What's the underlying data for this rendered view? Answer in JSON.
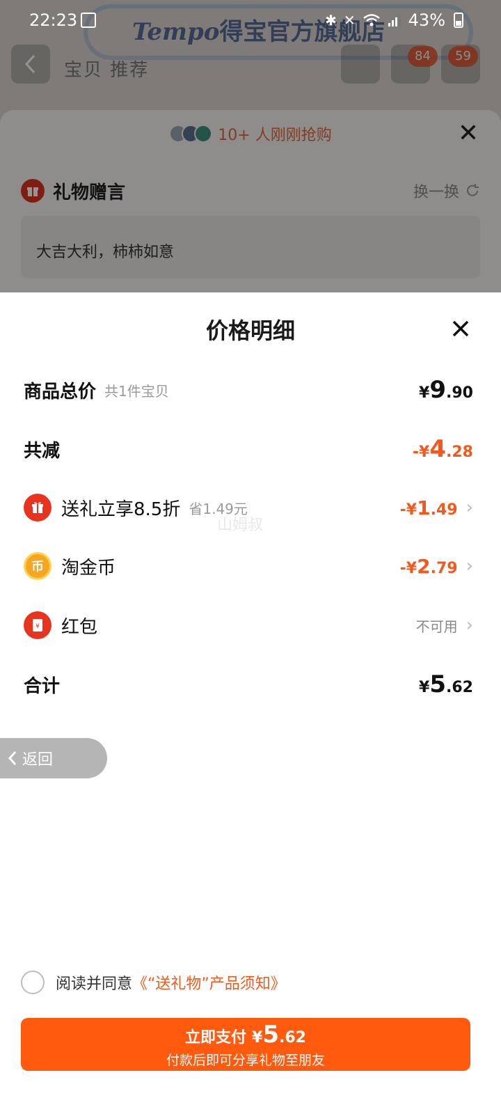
{
  "status_bar": {
    "time": "22:23",
    "battery": "43%"
  },
  "background_page": {
    "brand_script": "Tempo",
    "brand_name": "得宝官方旗舰店",
    "tabs": "宝贝 推荐",
    "cart_badge": "84",
    "more_badge": "59"
  },
  "gift_sheet": {
    "buyers_text": "10+ 人刚刚抢购",
    "title": "礼物赠言",
    "switch_label": "换一换",
    "message": "大吉大利，柿柿如意"
  },
  "price_sheet": {
    "title": "价格明细",
    "watermark": "山姆叔",
    "total": {
      "label": "商品总价",
      "sub": "共1件宝贝",
      "sym": "¥",
      "int": "9",
      "dec": ".90"
    },
    "discount_total": {
      "label": "共减",
      "sym": "-¥",
      "int": "4",
      "dec": ".28"
    },
    "items": [
      {
        "label": "送礼立享8.5折",
        "sub": "省1.49元",
        "sym": "-¥",
        "int": "1",
        "dec": ".49",
        "icon": "gift-icon"
      },
      {
        "label": "淘金币",
        "sym": "-¥",
        "int": "2",
        "dec": ".79",
        "icon": "coin-icon"
      },
      {
        "label": "红包",
        "status": "不可用",
        "icon": "red-packet-icon"
      }
    ],
    "sum": {
      "label": "合计",
      "sym": "¥",
      "int": "5",
      "dec": ".62"
    }
  },
  "back_button": {
    "label": "返回"
  },
  "agreement": {
    "text": "阅读并同意",
    "link": "《“送礼物”产品须知》"
  },
  "pay_button": {
    "label": "立即支付",
    "sym": "¥",
    "int": "5",
    "dec": ".62",
    "sub": "付款后即可分享礼物至朋友"
  },
  "colors": {
    "accent": "#ff5a0d",
    "discount": "#f25a1c"
  }
}
